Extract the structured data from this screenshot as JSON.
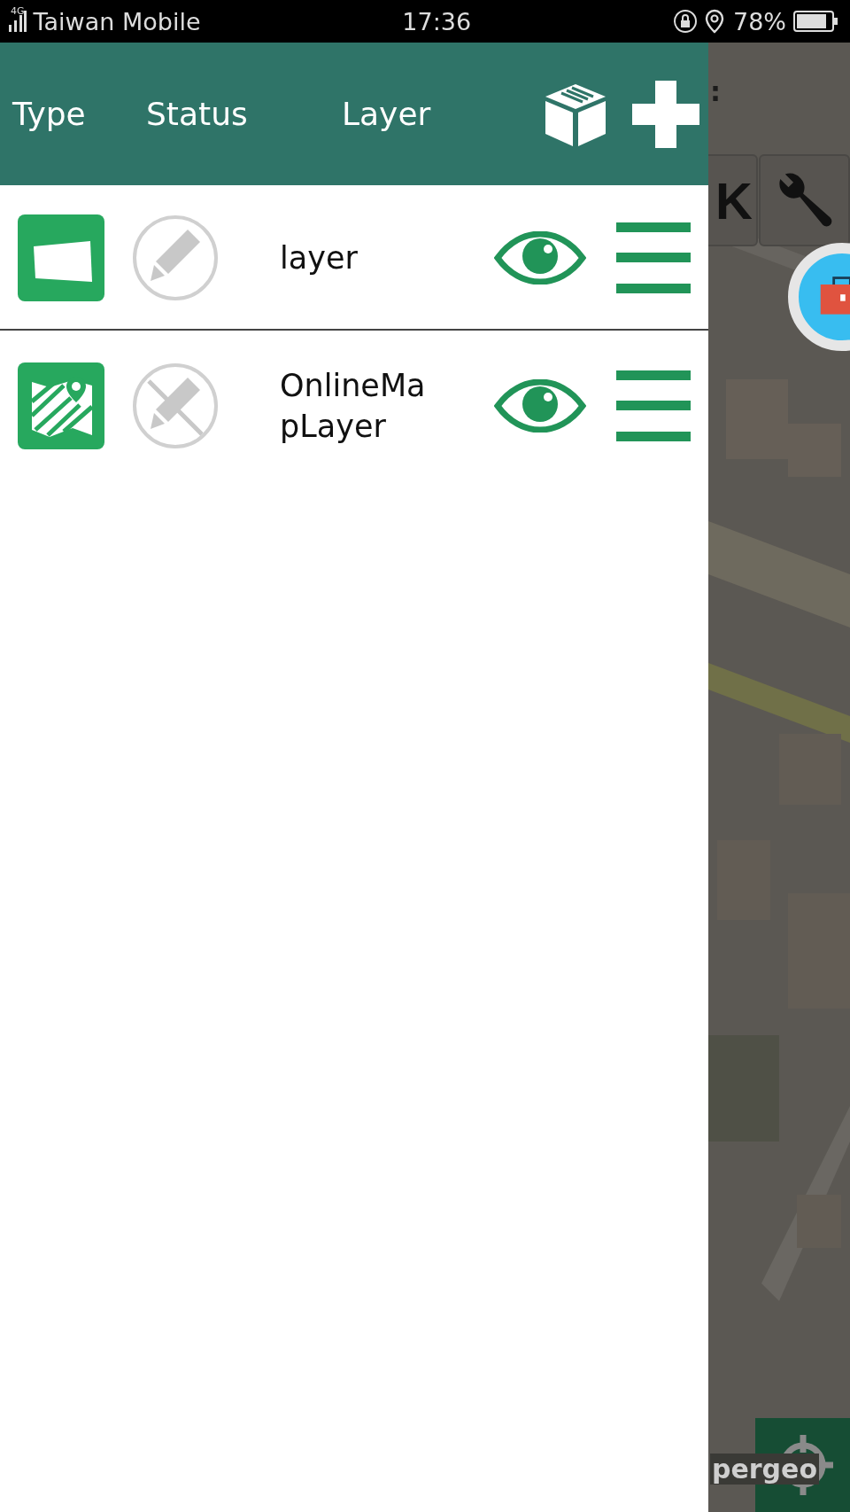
{
  "status_bar": {
    "network": "4G",
    "carrier": "Taiwan Mobile",
    "time": "17:36",
    "battery": "78%"
  },
  "drawer": {
    "columns": [
      "Type",
      "Status",
      "Layer"
    ],
    "layers": [
      {
        "name": "layer",
        "kind": "vector",
        "editable": true,
        "visible": true
      },
      {
        "name": "OnlineMa\npLayer",
        "kind": "online_map",
        "editable": false,
        "visible": true
      }
    ]
  },
  "map_overlay": {
    "title_fragment": ":",
    "ok_button": "K",
    "logo": "pergeo"
  }
}
